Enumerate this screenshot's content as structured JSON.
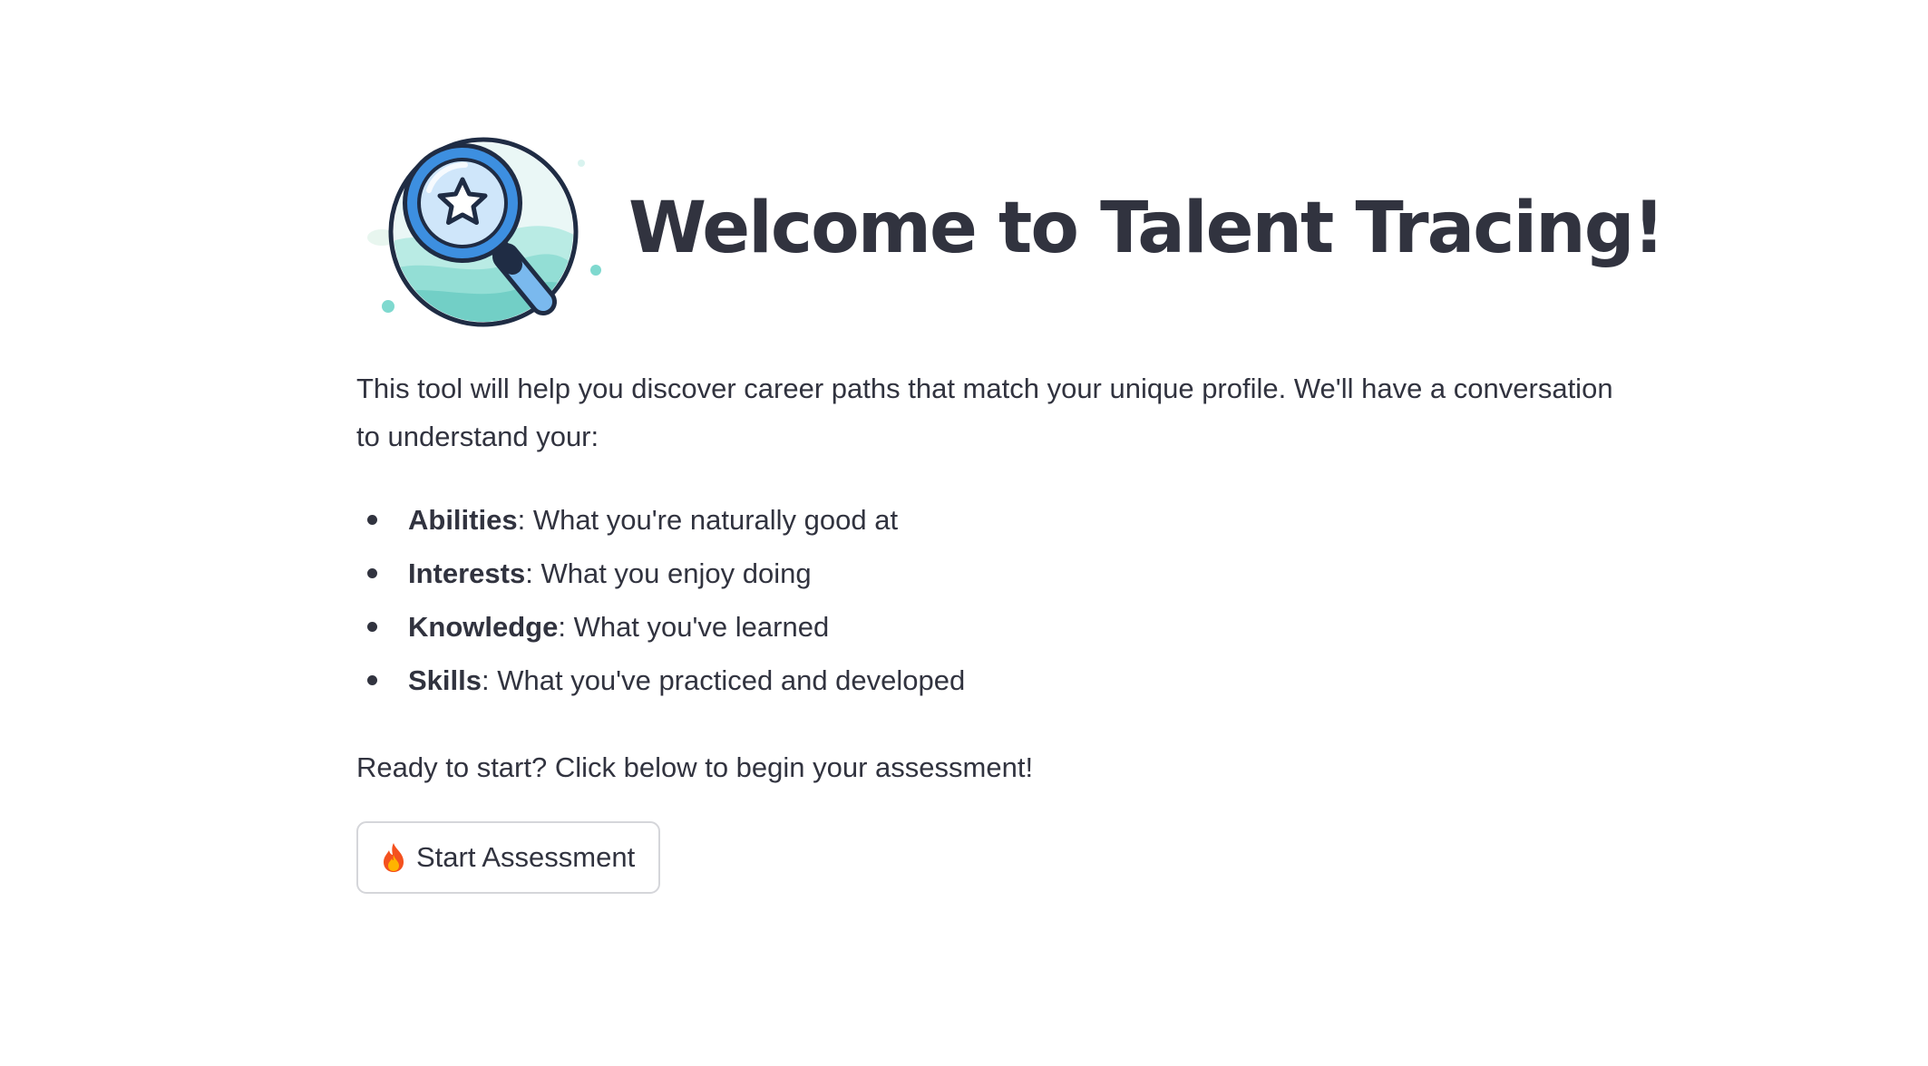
{
  "header": {
    "title": "Welcome to Talent Tracing!",
    "logo_icon": "magnifying-glass-star-icon"
  },
  "intro": {
    "text": "This tool will help you discover career paths that match your unique profile. We'll have a conversation to understand your:"
  },
  "features": [
    {
      "term": "Abilities",
      "description": ": What you're naturally good at"
    },
    {
      "term": "Interests",
      "description": ": What you enjoy doing"
    },
    {
      "term": "Knowledge",
      "description": ": What you've learned"
    },
    {
      "term": "Skills",
      "description": ": What you've practiced and developed"
    }
  ],
  "cta": {
    "text": "Ready to start? Click below to begin your assessment!",
    "button_label": "Start Assessment",
    "button_icon": "fire-icon"
  },
  "colors": {
    "text": "#31333f",
    "button_border": "#d5d6da",
    "logo_blue": "#3d8fe0",
    "logo_teal": "#7fd9cf"
  }
}
